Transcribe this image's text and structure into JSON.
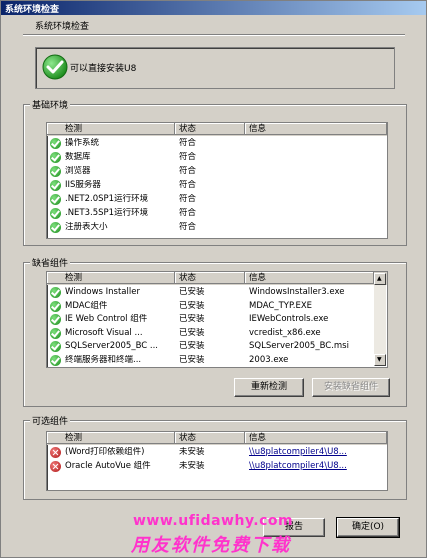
{
  "window": {
    "title": "系统环境检查"
  },
  "header": {
    "label": "系统环境检查"
  },
  "status": {
    "text": "可以直接安装U8"
  },
  "basic_env": {
    "title": "基础环境",
    "columns": [
      "检测",
      "状态",
      "信息"
    ],
    "rows": [
      {
        "name": "操作系统",
        "status": "符合",
        "info": "",
        "icon": "check-icon"
      },
      {
        "name": "数据库",
        "status": "符合",
        "info": "",
        "icon": "check-icon"
      },
      {
        "name": "浏览器",
        "status": "符合",
        "info": "",
        "icon": "check-icon"
      },
      {
        "name": "IIS服务器",
        "status": "符合",
        "info": "",
        "icon": "check-icon"
      },
      {
        "name": ".NET2.0SP1运行环境",
        "status": "符合",
        "info": "",
        "icon": "check-icon"
      },
      {
        "name": ".NET3.5SP1运行环境",
        "status": "符合",
        "info": "",
        "icon": "check-icon"
      },
      {
        "name": "注册表大小",
        "status": "符合",
        "info": "",
        "icon": "check-icon"
      }
    ]
  },
  "default_components": {
    "title": "缺省组件",
    "columns": [
      "检测",
      "状态",
      "信息"
    ],
    "rows": [
      {
        "name": "Windows Installer",
        "status": "已安装",
        "info": "WindowsInstaller3.exe",
        "icon": "check-icon"
      },
      {
        "name": "MDAC组件",
        "status": "已安装",
        "info": "MDAC_TYP.EXE",
        "icon": "check-icon"
      },
      {
        "name": "IE Web Control 组件",
        "status": "已安装",
        "info": "IEWebControls.exe",
        "icon": "check-icon"
      },
      {
        "name": "Microsoft Visual ...",
        "status": "已安装",
        "info": "vcredist_x86.exe",
        "icon": "check-icon"
      },
      {
        "name": "SQLServer2005_BC ...",
        "status": "已安装",
        "info": "SQLServer2005_BC.msi",
        "icon": "check-icon"
      },
      {
        "name": "终端服务器和终端...",
        "status": "已安装",
        "info": "2003.exe",
        "icon": "check-icon"
      }
    ],
    "recheck_label": "重新检测",
    "install_label": "安装缺省组件"
  },
  "optional_components": {
    "title": "可选组件",
    "columns": [
      "检测",
      "状态",
      "信息"
    ],
    "rows": [
      {
        "name": "(Word打印依赖组件)",
        "status": "未安装",
        "info": "\\\\u8platcompiler4\\U8...",
        "icon": "error-icon"
      },
      {
        "name": "Oracle AutoVue 组件",
        "status": "未安装",
        "info": "\\\\u8platcompiler4\\U8...",
        "icon": "error-icon"
      }
    ]
  },
  "footer": {
    "report_label": "报告",
    "ok_label": "确定(O)"
  },
  "watermark": {
    "url": "www.ufidawhy.com",
    "slogan": "用友软件免费下载"
  },
  "colors": {
    "title_bar": "#0a246a",
    "watermark": "#ff33cc",
    "ok_icon": "#1c8c1c",
    "error_icon": "#b01818"
  }
}
